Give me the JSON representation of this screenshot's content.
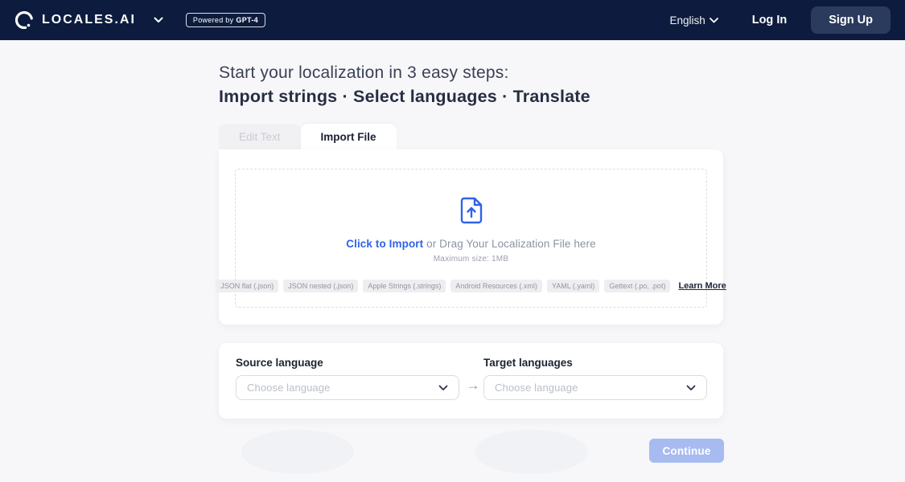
{
  "header": {
    "brand": "LOCALES.AI",
    "powered_by_label": "Powered by",
    "powered_by_model": "GPT-4",
    "language_selected": "English",
    "login_label": "Log In",
    "signup_label": "Sign Up"
  },
  "hero": {
    "title_line1": "Start your localization in 3 easy steps:",
    "title_line2": "Import strings · Select languages · Translate"
  },
  "tabs": [
    {
      "label": "Edit Text",
      "active": false
    },
    {
      "label": "Import File",
      "active": true
    }
  ],
  "dropzone": {
    "click_label": "Click to Import",
    "drag_label": " or Drag Your Localization File here",
    "max_size": "Maximum size: 1MB",
    "formats": [
      "JSON flat (.json)",
      "JSON nested (.json)",
      "Apple Strings (.strings)",
      "Android Resources (.xml)",
      "YAML (.yaml)",
      "Gettext (.po, .pot)"
    ],
    "learn_more_label": "Learn More"
  },
  "language_form": {
    "source_label": "Source language",
    "target_label": "Target languages",
    "source_placeholder": "Choose language",
    "target_placeholder": "Choose language",
    "continue_label": "Continue"
  },
  "colors": {
    "header_bg": "#0d1c3e",
    "accent_blue": "#2f63e8",
    "continue_disabled": "#a7bbf1",
    "page_bg": "#f7f7f9"
  }
}
